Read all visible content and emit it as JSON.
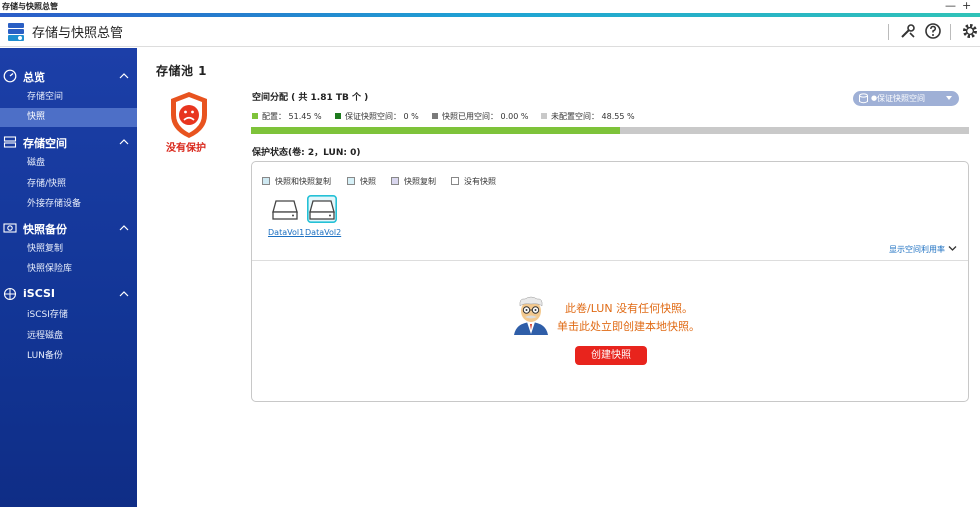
{
  "window": {
    "title": "存储与快照总管",
    "minimize_glyph": "—",
    "maximize_glyph": "+"
  },
  "app": {
    "title": "存储与快照总管"
  },
  "header_icons": [
    "tools-icon",
    "help-icon",
    "gear-icon"
  ],
  "sidebar": {
    "sections": [
      {
        "label": "总览",
        "icon": "dashboard-icon",
        "items": [
          {
            "label": "存储空间",
            "active": false
          },
          {
            "label": "快照",
            "active": true
          }
        ]
      },
      {
        "label": "存储空间",
        "icon": "storage-icon",
        "items": [
          {
            "label": "磁盘"
          },
          {
            "label": "存储/快照"
          },
          {
            "label": "外接存储设备"
          }
        ]
      },
      {
        "label": "快照备份",
        "icon": "backup-icon",
        "items": [
          {
            "label": "快照复制"
          },
          {
            "label": "快照保险库"
          }
        ]
      },
      {
        "label": "iSCSI",
        "icon": "iscsi-icon",
        "items": [
          {
            "label": "iSCSI存储"
          },
          {
            "label": "远程磁盘"
          },
          {
            "label": "LUN备份"
          }
        ]
      }
    ]
  },
  "pool": {
    "title": "存储池 1",
    "status_label": "没有保护",
    "allocation_title": "空间分配 ( 共 1.81 TB 个 )",
    "legend": [
      {
        "label": "配置： 51.45 %",
        "color": "#7ec33a"
      },
      {
        "label": "保证快照空间： 0 %",
        "color": "#1e7a1e"
      },
      {
        "label": "快照已用空间： 0.00 %",
        "color": "#7a7a7a"
      },
      {
        "label": "未配置空间： 48.55 %",
        "color": "#c9c9c9"
      }
    ],
    "used_percent": 51.45,
    "guarantee_button": "保证快照空间"
  },
  "protection": {
    "title": "保护状态(卷: 2，LUN: 0)",
    "filters": [
      {
        "label": "快照和快照复制",
        "color": "#cfe9f2"
      },
      {
        "label": "快照",
        "color": "#d6f0f7"
      },
      {
        "label": "快照复制",
        "color": "#d9d6ee"
      },
      {
        "label": "没有快照",
        "color": "#ffffff"
      }
    ],
    "volumes": [
      "DataVol1",
      "DataVol2"
    ],
    "show_usage_label": "显示空间利用率"
  },
  "empty_state": {
    "line1": "此卷/LUN 没有任何快照。",
    "line2": "单击此处立即创建本地快照。",
    "button": "创建快照"
  }
}
